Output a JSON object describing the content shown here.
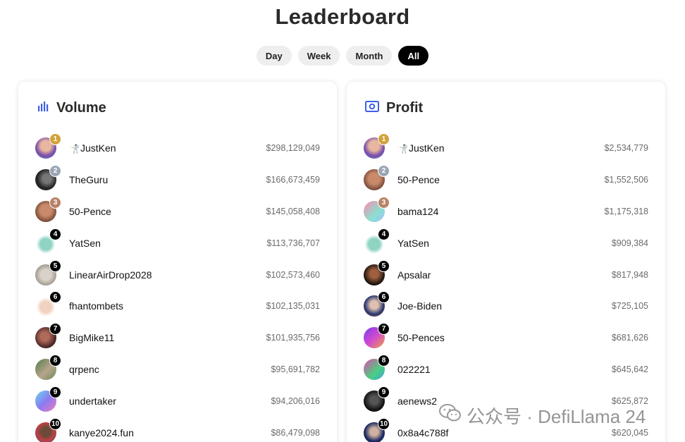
{
  "page": {
    "title": "Leaderboard"
  },
  "filters": [
    {
      "label": "Day",
      "active": false
    },
    {
      "label": "Week",
      "active": false
    },
    {
      "label": "Month",
      "active": false
    },
    {
      "label": "All",
      "active": true
    }
  ],
  "colors": {
    "gold": "#d4a23a",
    "silver": "#9aa6b4",
    "bronze": "#b98267",
    "rank_default": "#000000",
    "accent_blue": "#3d5fe8"
  },
  "volume": {
    "title": "Volume",
    "icon": "bar-chart-icon",
    "rows": [
      {
        "rank": "1",
        "name": "JustKen",
        "prefix": "🤺",
        "amount": "$298,129,049"
      },
      {
        "rank": "2",
        "name": "TheGuru",
        "prefix": "",
        "amount": "$166,673,459"
      },
      {
        "rank": "3",
        "name": "50-Pence",
        "prefix": "",
        "amount": "$145,058,408"
      },
      {
        "rank": "4",
        "name": "YatSen",
        "prefix": "",
        "amount": "$113,736,707"
      },
      {
        "rank": "5",
        "name": "LinearAirDrop2028",
        "prefix": "",
        "amount": "$102,573,460"
      },
      {
        "rank": "6",
        "name": "fhantombets",
        "prefix": "",
        "amount": "$102,135,031"
      },
      {
        "rank": "7",
        "name": "BigMike11",
        "prefix": "",
        "amount": "$101,935,756"
      },
      {
        "rank": "8",
        "name": "qrpenc",
        "prefix": "",
        "amount": "$95,691,782"
      },
      {
        "rank": "9",
        "name": "undertaker",
        "prefix": "",
        "amount": "$94,206,016"
      },
      {
        "rank": "10",
        "name": "kanye2024.fun",
        "prefix": "",
        "amount": "$86,479,098"
      }
    ]
  },
  "profit": {
    "title": "Profit",
    "icon": "banknote-icon",
    "rows": [
      {
        "rank": "1",
        "name": "JustKen",
        "prefix": "🤺",
        "amount": "$2,534,779"
      },
      {
        "rank": "2",
        "name": "50-Pence",
        "prefix": "",
        "amount": "$1,552,506"
      },
      {
        "rank": "3",
        "name": "bama124",
        "prefix": "",
        "amount": "$1,175,318"
      },
      {
        "rank": "4",
        "name": "YatSen",
        "prefix": "",
        "amount": "$909,384"
      },
      {
        "rank": "5",
        "name": "Apsalar",
        "prefix": "",
        "amount": "$817,948"
      },
      {
        "rank": "6",
        "name": "Joe-Biden",
        "prefix": "",
        "amount": "$725,105"
      },
      {
        "rank": "7",
        "name": "50-Pences",
        "prefix": "",
        "amount": "$681,626"
      },
      {
        "rank": "8",
        "name": "022221",
        "prefix": "",
        "amount": "$645,642"
      },
      {
        "rank": "9",
        "name": "aenews2",
        "prefix": "",
        "amount": "$625,872"
      },
      {
        "rank": "10",
        "name": "0x8a4c788f",
        "prefix": "",
        "amount": "$620,045"
      }
    ]
  },
  "watermark": {
    "text": "公众号 · DefiLlama 24"
  }
}
